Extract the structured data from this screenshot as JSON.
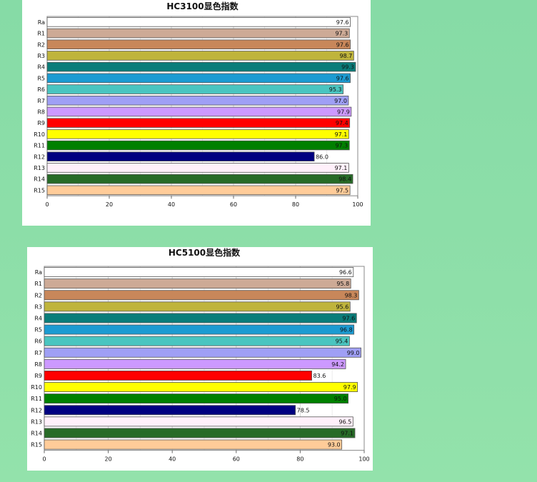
{
  "chart_data": [
    {
      "type": "bar",
      "orientation": "horizontal",
      "title": "HC3100显色指数",
      "categories": [
        "Ra",
        "R1",
        "R2",
        "R3",
        "R4",
        "R5",
        "R6",
        "R7",
        "R8",
        "R9",
        "R10",
        "R11",
        "R12",
        "R13",
        "R14",
        "R15"
      ],
      "values": [
        97.6,
        97.3,
        97.6,
        98.7,
        99.3,
        97.6,
        95.3,
        97.0,
        97.9,
        97.4,
        97.1,
        97.3,
        86.0,
        97.1,
        98.4,
        97.5
      ],
      "value_labels": [
        "97.6",
        "97.3",
        "97.6",
        "98.7",
        "99.3",
        "97.6",
        "95.3",
        "97.0",
        "97.9",
        "97.4",
        "97.1",
        "97.3",
        "86.0",
        "97.1",
        "98.4",
        "97.5"
      ],
      "colors": [
        "#ffffff",
        "#cdaa96",
        "#c8875a",
        "#bfb43c",
        "#0a7d7a",
        "#1c9bd2",
        "#4ac5c0",
        "#9f9ff5",
        "#cc99ff",
        "#ff0000",
        "#ffff00",
        "#008000",
        "#000080",
        "#fff0fa",
        "#276b27",
        "#ffcc99"
      ],
      "xlim": [
        0,
        100
      ],
      "xticks": [
        "0",
        "20",
        "40",
        "60",
        "80",
        "100"
      ],
      "grid": true
    },
    {
      "type": "bar",
      "orientation": "horizontal",
      "title": "HC5100显色指数",
      "categories": [
        "Ra",
        "R1",
        "R2",
        "R3",
        "R4",
        "R5",
        "R6",
        "R7",
        "R8",
        "R9",
        "R10",
        "R11",
        "R12",
        "R13",
        "R14",
        "R15"
      ],
      "values": [
        96.6,
        95.8,
        98.3,
        95.6,
        97.6,
        96.8,
        95.4,
        99.0,
        94.2,
        83.6,
        97.9,
        95.0,
        78.5,
        96.5,
        97.1,
        93.0
      ],
      "value_labels": [
        "96.6",
        "95.8",
        "98.3",
        "95.6",
        "97.6",
        "96.8",
        "95.4",
        "99.0",
        "94.2",
        "83.6",
        "97.9",
        "95.0",
        "78.5",
        "96.5",
        "97.1",
        "93.0"
      ],
      "colors": [
        "#ffffff",
        "#cdaa96",
        "#c8875a",
        "#bfb43c",
        "#0a7d7a",
        "#1c9bd2",
        "#4ac5c0",
        "#9f9ff5",
        "#cc99ff",
        "#ff0000",
        "#ffff00",
        "#008000",
        "#000080",
        "#fff0fa",
        "#276b27",
        "#ffcc99"
      ],
      "xlim": [
        0,
        100
      ],
      "xticks": [
        "0",
        "20",
        "40",
        "60",
        "80",
        "100"
      ],
      "grid": true
    }
  ]
}
